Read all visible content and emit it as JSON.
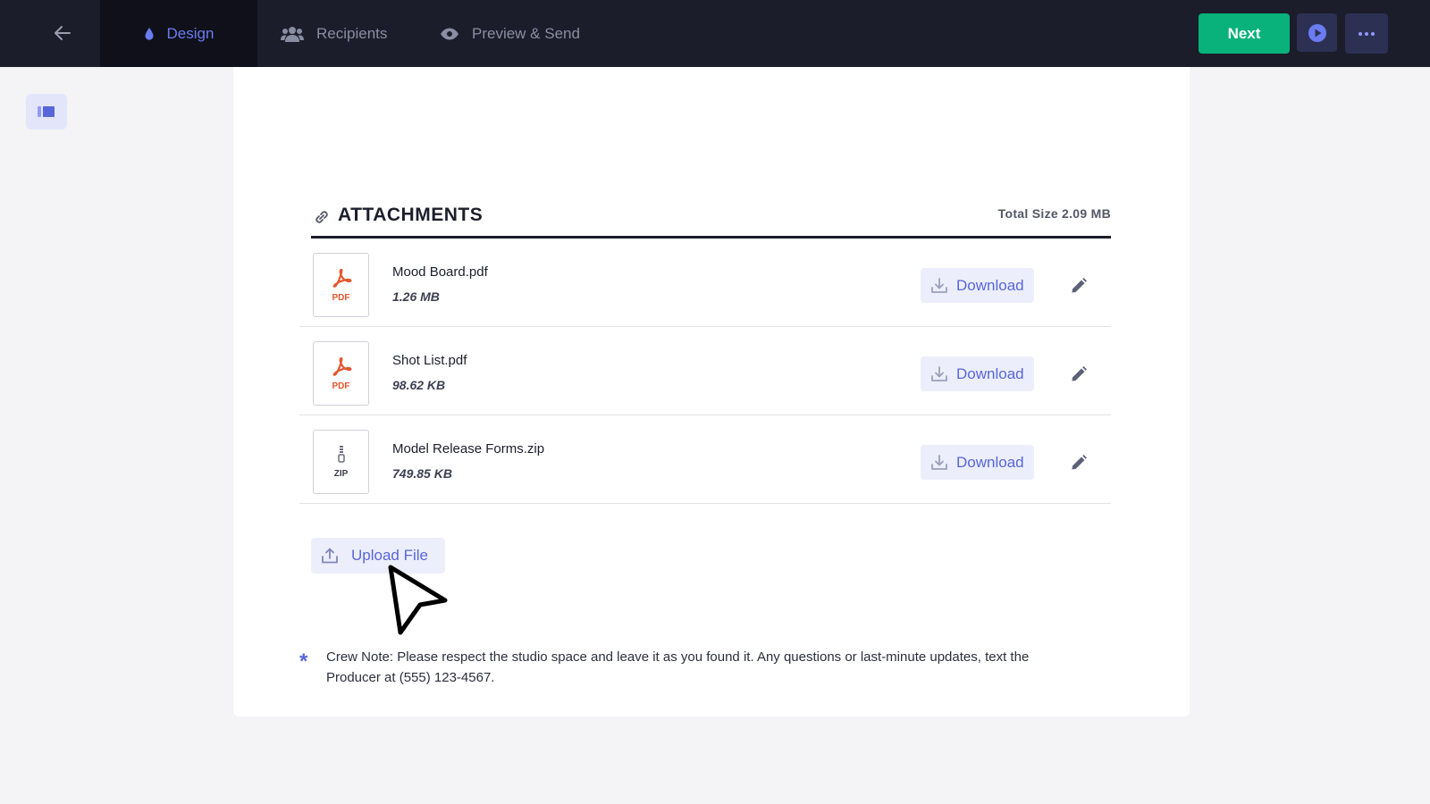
{
  "topbar": {
    "tabs": [
      {
        "label": "Design",
        "icon": "droplet-icon",
        "active": true
      },
      {
        "label": "Recipients",
        "icon": "people-icon",
        "active": false
      },
      {
        "label": "Preview & Send",
        "icon": "eye-icon",
        "active": false
      }
    ],
    "next_label": "Next",
    "colors": {
      "bar": "#1b1d2a",
      "active_tab": "#0f1019",
      "accent": "#6b7cf2",
      "next": "#08b27a"
    }
  },
  "attachments": {
    "title": "ATTACHMENTS",
    "total_label": "Total Size",
    "total_value": "2.09 MB",
    "files": [
      {
        "name": "Mood Board.pdf",
        "size": "1.26 MB",
        "type": "PDF",
        "download_label": "Download"
      },
      {
        "name": "Shot List.pdf",
        "size": "98.62 KB",
        "type": "PDF",
        "download_label": "Download"
      },
      {
        "name": "Model Release Forms.zip",
        "size": "749.85 KB",
        "type": "ZIP",
        "download_label": "Download"
      }
    ],
    "upload_label": "Upload File"
  },
  "note": {
    "marker": "*",
    "text": "Crew Note: Please respect the studio space and leave it as you found it. Any questions or last-minute updates, text the Producer at (555) 123-4567."
  }
}
